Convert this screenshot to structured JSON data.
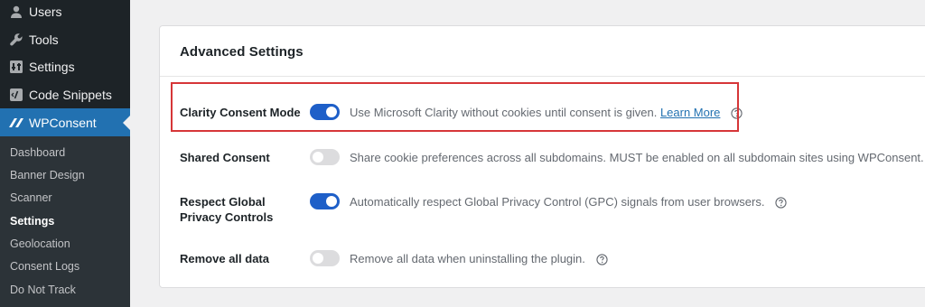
{
  "sidebar": {
    "menu": [
      {
        "label": "Users",
        "icon": "users-icon",
        "active": false
      },
      {
        "label": "Tools",
        "icon": "wrench-icon",
        "active": false
      },
      {
        "label": "Settings",
        "icon": "settings-icon",
        "active": false
      },
      {
        "label": "Code Snippets",
        "icon": "code-snippets-icon",
        "active": false
      },
      {
        "label": "WPConsent",
        "icon": "wpconsent-logo-icon",
        "active": true
      }
    ],
    "submenu": [
      {
        "label": "Dashboard",
        "current": false
      },
      {
        "label": "Banner Design",
        "current": false
      },
      {
        "label": "Scanner",
        "current": false
      },
      {
        "label": "Settings",
        "current": true
      },
      {
        "label": "Geolocation",
        "current": false
      },
      {
        "label": "Consent Logs",
        "current": false
      },
      {
        "label": "Do Not Track",
        "current": false
      }
    ]
  },
  "panel": {
    "title": "Advanced Settings",
    "rows": [
      {
        "label": "Clarity Consent Mode",
        "enabled": true,
        "description": "Use Microsoft Clarity without cookies until consent is given.",
        "link": "Learn More",
        "help_icon": "help-icon"
      },
      {
        "label": "Shared Consent",
        "enabled": false,
        "description": "Share cookie preferences across all subdomains. MUST be enabled on all subdomain sites using WPConsent.",
        "help_icon": "help-icon"
      },
      {
        "label": "Respect Global Privacy Controls",
        "enabled": true,
        "description": "Automatically respect Global Privacy Control (GPC) signals from user browsers.",
        "help_icon": "help-icon"
      },
      {
        "label": "Remove all data",
        "enabled": false,
        "description": "Remove all data when uninstalling the plugin.",
        "help_icon": "help-icon"
      }
    ]
  },
  "colors": {
    "sidebar_bg": "#1d2327",
    "active_menu": "#2271b1",
    "toggle_on": "#1e5fc8",
    "highlight": "#d63638"
  }
}
